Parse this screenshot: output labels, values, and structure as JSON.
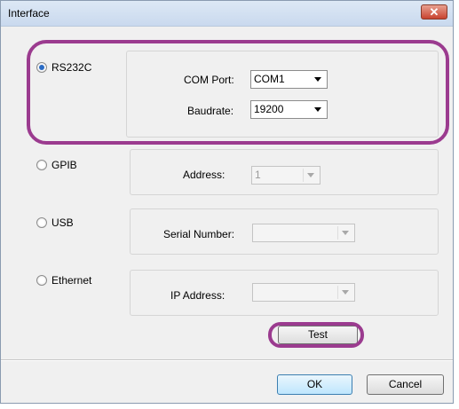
{
  "window": {
    "title": "Interface",
    "close_symbol": "✕",
    "close_icon": "close-icon"
  },
  "rs232c": {
    "label": "RS232C",
    "selected": true,
    "com_port_label": "COM Port:",
    "com_port_value": "COM1",
    "baudrate_label": "Baudrate:",
    "baudrate_value": "19200"
  },
  "gpib": {
    "label": "GPIB",
    "selected": false,
    "address_label": "Address:",
    "address_value": "1"
  },
  "usb": {
    "label": "USB",
    "selected": false,
    "serial_label": "Serial Number:",
    "serial_value": ""
  },
  "ethernet": {
    "label": "Ethernet",
    "selected": false,
    "ip_label": "IP Address:",
    "ip_value": ""
  },
  "buttons": {
    "test": "Test",
    "ok": "OK",
    "cancel": "Cancel"
  },
  "colors": {
    "highlight": "#9b3b8f",
    "radio_selected": "#2a6bc4"
  }
}
